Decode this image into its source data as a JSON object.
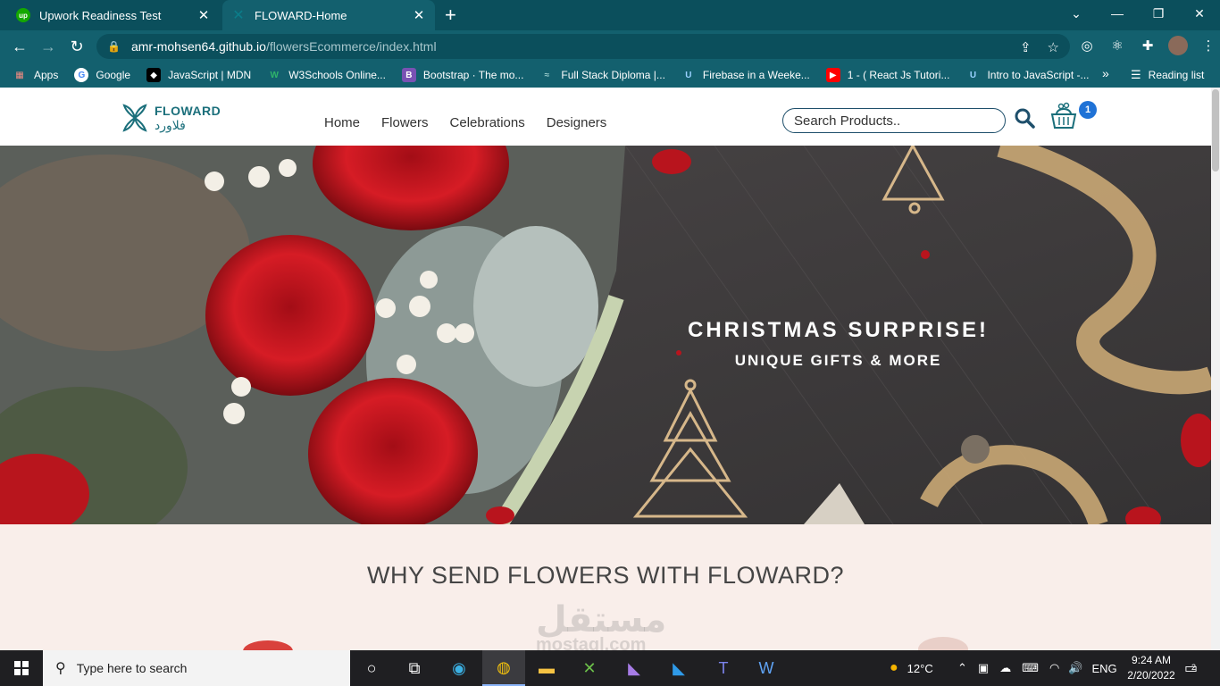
{
  "browser": {
    "tabs": [
      {
        "title": "Upwork Readiness Test",
        "favicon": "upwork-icon",
        "active": false
      },
      {
        "title": "FLOWARD-Home",
        "favicon": "floward-icon",
        "active": true
      }
    ],
    "address": {
      "host": "amr-mohsen64.github.io",
      "path": "/flowersEcommerce/index.html"
    },
    "bookmarks": [
      {
        "label": "Apps",
        "icon": "apps-grid-icon"
      },
      {
        "label": "Google",
        "icon": "google-icon"
      },
      {
        "label": "JavaScript | MDN",
        "icon": "mdn-icon"
      },
      {
        "label": "W3Schools Online...",
        "icon": "w3schools-icon"
      },
      {
        "label": "Bootstrap · The mo...",
        "icon": "bootstrap-icon"
      },
      {
        "label": "Full Stack Diploma |...",
        "icon": "diploma-icon"
      },
      {
        "label": "Firebase in a Weeke...",
        "icon": "udemy-icon"
      },
      {
        "label": "1 - ( React Js Tutori...",
        "icon": "youtube-icon"
      },
      {
        "label": "Intro to JavaScript -...",
        "icon": "udemy-icon"
      }
    ],
    "reading_list": "Reading list",
    "more_bookmarks": "»"
  },
  "site": {
    "logo": {
      "en": "FLOWARD",
      "ar": "فلاورد"
    },
    "nav": [
      "Home",
      "Flowers",
      "Celebrations",
      "Designers"
    ],
    "search_placeholder": "Search Products..",
    "cart_count": "1",
    "hero": {
      "title": "CHRISTMAS SURPRISE!",
      "subtitle": "UNIQUE GIFTS & MORE"
    },
    "why_title": "WHY SEND FLOWERS WITH FLOWARD?",
    "watermark": {
      "ar": "مستقل",
      "en": "mostaql.com"
    }
  },
  "taskbar": {
    "search_placeholder": "Type here to search",
    "weather": "12°C",
    "language": "ENG",
    "time": "9:24 AM",
    "date": "2/20/2022",
    "notifications": "2"
  },
  "colors": {
    "brand": "#1b6f7b",
    "chrome": "#13606e",
    "hero_bg": "#3c3a3b",
    "why_bg": "#f9eeea",
    "badge": "#1f72d6"
  }
}
